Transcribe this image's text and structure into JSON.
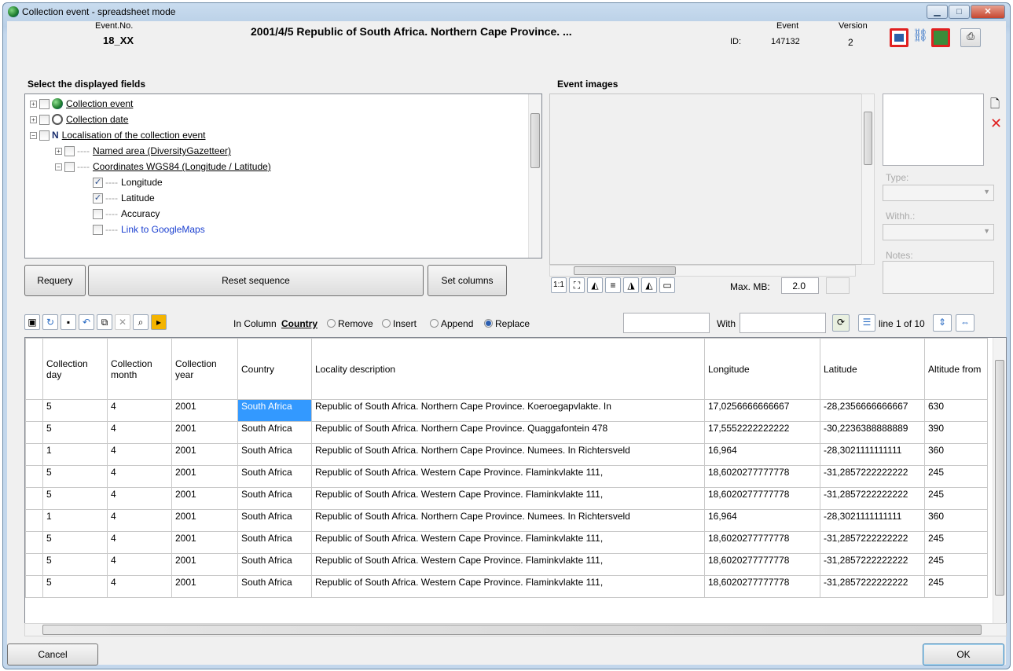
{
  "window": {
    "title": "Collection event - spreadsheet mode",
    "buttons": [
      "▁",
      "□",
      "✕"
    ]
  },
  "header": {
    "event_no_label": "Event.No.",
    "event_no": "18_XX",
    "event_title": "2001/4/5 Republic of South Africa. Northern Cape Province.  ...",
    "event_id_label1": "Event",
    "event_id_label2": "ID:",
    "event_id": "147132",
    "version_label": "Version",
    "version": "2"
  },
  "fields_section": {
    "title": "Select the displayed fields",
    "tree": [
      {
        "label": "Collection event",
        "checked": false,
        "expander": "⊞",
        "icon": "globe-icon"
      },
      {
        "label": "Collection date",
        "checked": false,
        "expander": "⊞",
        "icon": "clock-icon"
      },
      {
        "label": "Localisation of the collection event",
        "checked": false,
        "expander": "⊟",
        "icon": "north-arrow-icon"
      },
      {
        "label": "Named area (DiversityGazetteer)",
        "checked": false,
        "expander": "⊞"
      },
      {
        "label": "Coordinates WGS84 (Longitude / Latitude)",
        "checked": false,
        "expander": "⊟"
      },
      {
        "label": "Longitude",
        "checked": true
      },
      {
        "label": "Latitude",
        "checked": true
      },
      {
        "label": "Accuracy",
        "checked": false
      },
      {
        "label": "Link to GoogleMaps",
        "checked": false
      }
    ],
    "requery": "Requery",
    "reset": "Reset sequence",
    "set_columns": "Set columns"
  },
  "images": {
    "title": "Event images",
    "type_label": "Type:",
    "withh_label": "Withh.:",
    "notes_label": "Notes:",
    "maxmb_label": "Max. MB:",
    "maxmb": "2.0",
    "zoom_label": "1:1"
  },
  "toolbar": {
    "in_column": "In Column",
    "column": "Country",
    "remove": "Remove",
    "insert": "Insert",
    "append": "Append",
    "replace": "Replace",
    "with": "With",
    "line_info": "line 1 of 10",
    "selected_mode": "Replace"
  },
  "grid": {
    "headers": [
      "Collection day",
      "Collection month",
      "Collection year",
      "Country",
      "Locality description",
      "Longitude",
      "Latitude",
      "Altitude from"
    ],
    "rows": [
      [
        "5",
        "4",
        "2001",
        "South Africa",
        "Republic of South Africa. Northern Cape Province. Koeroegapvlakte. In",
        "17,0256666666667",
        "-28,2356666666667",
        "630"
      ],
      [
        "5",
        "4",
        "2001",
        "South Africa",
        "Republic of South Africa. Northern Cape Province. Quaggafontein 478",
        "17,5552222222222",
        "-30,2236388888889",
        "390"
      ],
      [
        "1",
        "4",
        "2001",
        "South Africa",
        "Republic of South Africa. Northern Cape Province. Numees. In Richtersveld",
        "16,964",
        "-28,3021111111111",
        "360"
      ],
      [
        "5",
        "4",
        "2001",
        "South Africa",
        "Republic of South Africa. Western Cape Province. Flaminkvlakte 111,",
        "18,6020277777778",
        "-31,2857222222222",
        "245"
      ],
      [
        "5",
        "4",
        "2001",
        "South Africa",
        "Republic of South Africa. Western Cape Province. Flaminkvlakte 111,",
        "18,6020277777778",
        "-31,2857222222222",
        "245"
      ],
      [
        "1",
        "4",
        "2001",
        "South Africa",
        "Republic of South Africa. Northern Cape Province. Numees. In Richtersveld",
        "16,964",
        "-28,3021111111111",
        "360"
      ],
      [
        "5",
        "4",
        "2001",
        "South Africa",
        "Republic of South Africa. Western Cape Province. Flaminkvlakte 111,",
        "18,6020277777778",
        "-31,2857222222222",
        "245"
      ],
      [
        "5",
        "4",
        "2001",
        "South Africa",
        "Republic of South Africa. Western Cape Province. Flaminkvlakte 111,",
        "18,6020277777778",
        "-31,2857222222222",
        "245"
      ],
      [
        "5",
        "4",
        "2001",
        "South Africa",
        "Republic of South Africa. Western Cape Province. Flaminkvlakte 111,",
        "18,6020277777778",
        "-31,2857222222222",
        "245"
      ]
    ]
  },
  "footer": {
    "cancel": "Cancel",
    "ok": "OK"
  },
  "colors": {
    "selected_cell": "#3399ff",
    "link": "#1a3fd0",
    "red_icon": "#e02020"
  }
}
